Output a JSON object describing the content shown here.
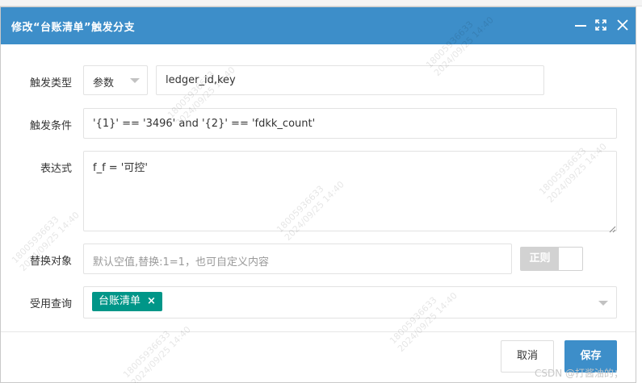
{
  "dialog": {
    "title": "修改“台账清单”触发分支",
    "icons": {
      "minimize": "minimize-icon",
      "maximize": "maximize-icon",
      "close": "close-icon"
    }
  },
  "form": {
    "trigger_type": {
      "label": "触发类型",
      "select_value": "参数",
      "input_value": "ledger_id,key"
    },
    "trigger_condition": {
      "label": "触发条件",
      "value": "'{1}' == '3496' and '{2}' == 'fdkk_count'"
    },
    "expression": {
      "label": "表达式",
      "value": "f_f = '可控'"
    },
    "replace_target": {
      "label": "替换对象",
      "placeholder": "默认空值,替换:1=1，也可自定义内容",
      "toggle_label": "正则"
    },
    "apply_query": {
      "label": "受用查询",
      "tag": "台账清单",
      "tag_remove": "×"
    }
  },
  "buttons": {
    "cancel": "取消",
    "save": "保存"
  },
  "watermark": {
    "id": "18005936633",
    "date": "2024/09/25 14:40"
  },
  "footer_credit": "CSDN @打酱油的；",
  "colors": {
    "titlebar": "#3d8ec9",
    "tag": "#009688",
    "primary": "#3d8ec9"
  }
}
